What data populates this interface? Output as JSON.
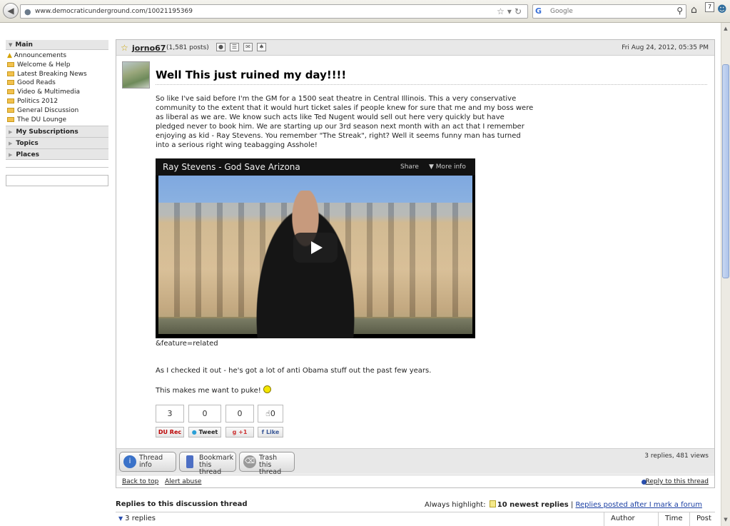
{
  "browser": {
    "url": "www.democraticunderground.com/10021195369",
    "search_placeholder": "Google",
    "badge_count": "7"
  },
  "sidebar": {
    "main_label": "Main",
    "items": [
      {
        "label": "Announcements",
        "icon": "warning-icon"
      },
      {
        "label": "Welcome & Help",
        "icon": "folder-icon"
      },
      {
        "label": "Latest Breaking News",
        "icon": "folder-icon"
      },
      {
        "label": "Good Reads",
        "icon": "folder-icon"
      },
      {
        "label": "Video & Multimedia",
        "icon": "folder-icon"
      },
      {
        "label": "Politics 2012",
        "icon": "folder-icon"
      },
      {
        "label": "General Discussion",
        "icon": "folder-icon"
      },
      {
        "label": "The DU Lounge",
        "icon": "folder-icon"
      }
    ],
    "sections": [
      "My Subscriptions",
      "Topics",
      "Places"
    ]
  },
  "post": {
    "author": "jorno67",
    "post_count": "(1,581 posts)",
    "date": "Fri Aug 24, 2012, 05:35 PM",
    "title": "Well This just ruined my day!!!!",
    "body": "So like I've said before I'm the GM for a 1500 seat theatre in Central Illinois. This a very conservative community to the extent that it would hurt ticket sales if people knew for sure that me and my boss were as liberal as we are. We know such acts like Ted Nugent would sell out here very quickly but have pledged never to book him. We are starting up our 3rd season next month with an act that I remember enjoying as kid - Ray Stevens. You remember \"The Streak\", right? Well it seems funny man has turned into a serious right wing teabagging Asshole!",
    "video_title": "Ray Stevens - God Save Arizona",
    "video_share": "Share",
    "video_more": "More info",
    "feature_text": "&feature=related",
    "para1": "As I checked it out - he's got a lot of anti Obama stuff out the past few years.",
    "para2": "This makes me want to puke!",
    "counters": {
      "du_rec": "3",
      "tweet": "0",
      "plus": "0",
      "like": "0"
    },
    "share_labels": {
      "du_rec": "DU Rec",
      "tweet": "Tweet",
      "plus": "+1",
      "like": "Like"
    },
    "footer_buttons": {
      "thread_info_1": "Thread",
      "thread_info_2": "info",
      "bookmark_1": "Bookmark",
      "bookmark_2": "this thread",
      "trash_1": "Trash",
      "trash_2": "this thread"
    },
    "stats": "3 replies, 481 views",
    "back_to_top": "Back to top",
    "alert_abuse": "Alert abuse",
    "reply_link": "Reply to this thread"
  },
  "replies": {
    "title": "Replies to this discussion thread",
    "highlight_label": "Always highlight:",
    "highlight_newest": "10 newest replies",
    "separator": "|",
    "highlight_after": "Replies posted after I mark a forum",
    "count": "3 replies",
    "columns": [
      "Author",
      "Time",
      "Post"
    ]
  }
}
